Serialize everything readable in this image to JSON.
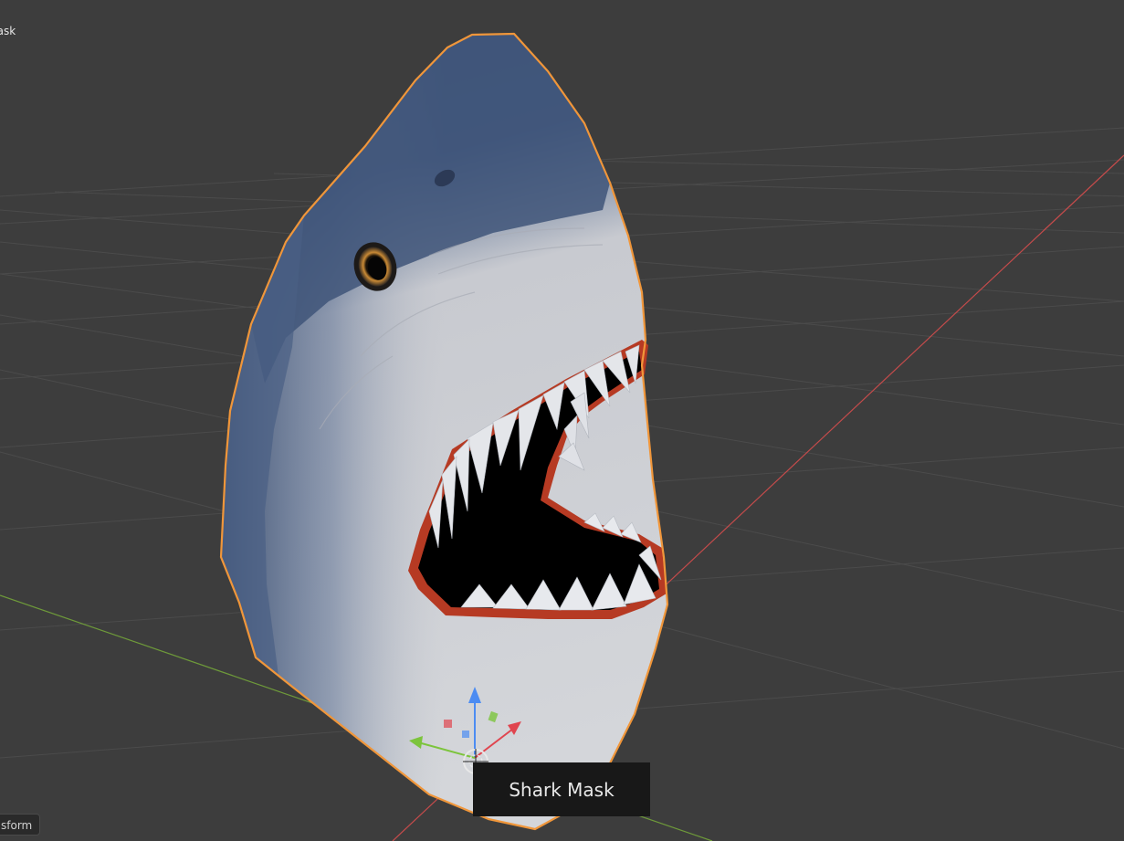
{
  "viewport": {
    "object_name_label": "hask",
    "transform_panel_label": "sform",
    "tooltip_text": "Shark Mask"
  },
  "colors": {
    "background": "#3d3d3d",
    "grid_line": "#4d4d4d",
    "x_axis": "#c44b4b",
    "y_axis": "#6e9a3a",
    "selection_outline": "#f0963a",
    "shark_top": "#3f5478",
    "shark_belly": "#c9cbd0",
    "mouth_rim": "#b63a23",
    "teeth": "#e4e6ea",
    "gizmo_z": "#4c8cf2",
    "gizmo_x": "#e0454f",
    "gizmo_y": "#7cc43c"
  },
  "icons": {
    "object_origin": "origin-crosshair-icon",
    "transform_gizmo": "transform-gizmo-icon"
  }
}
